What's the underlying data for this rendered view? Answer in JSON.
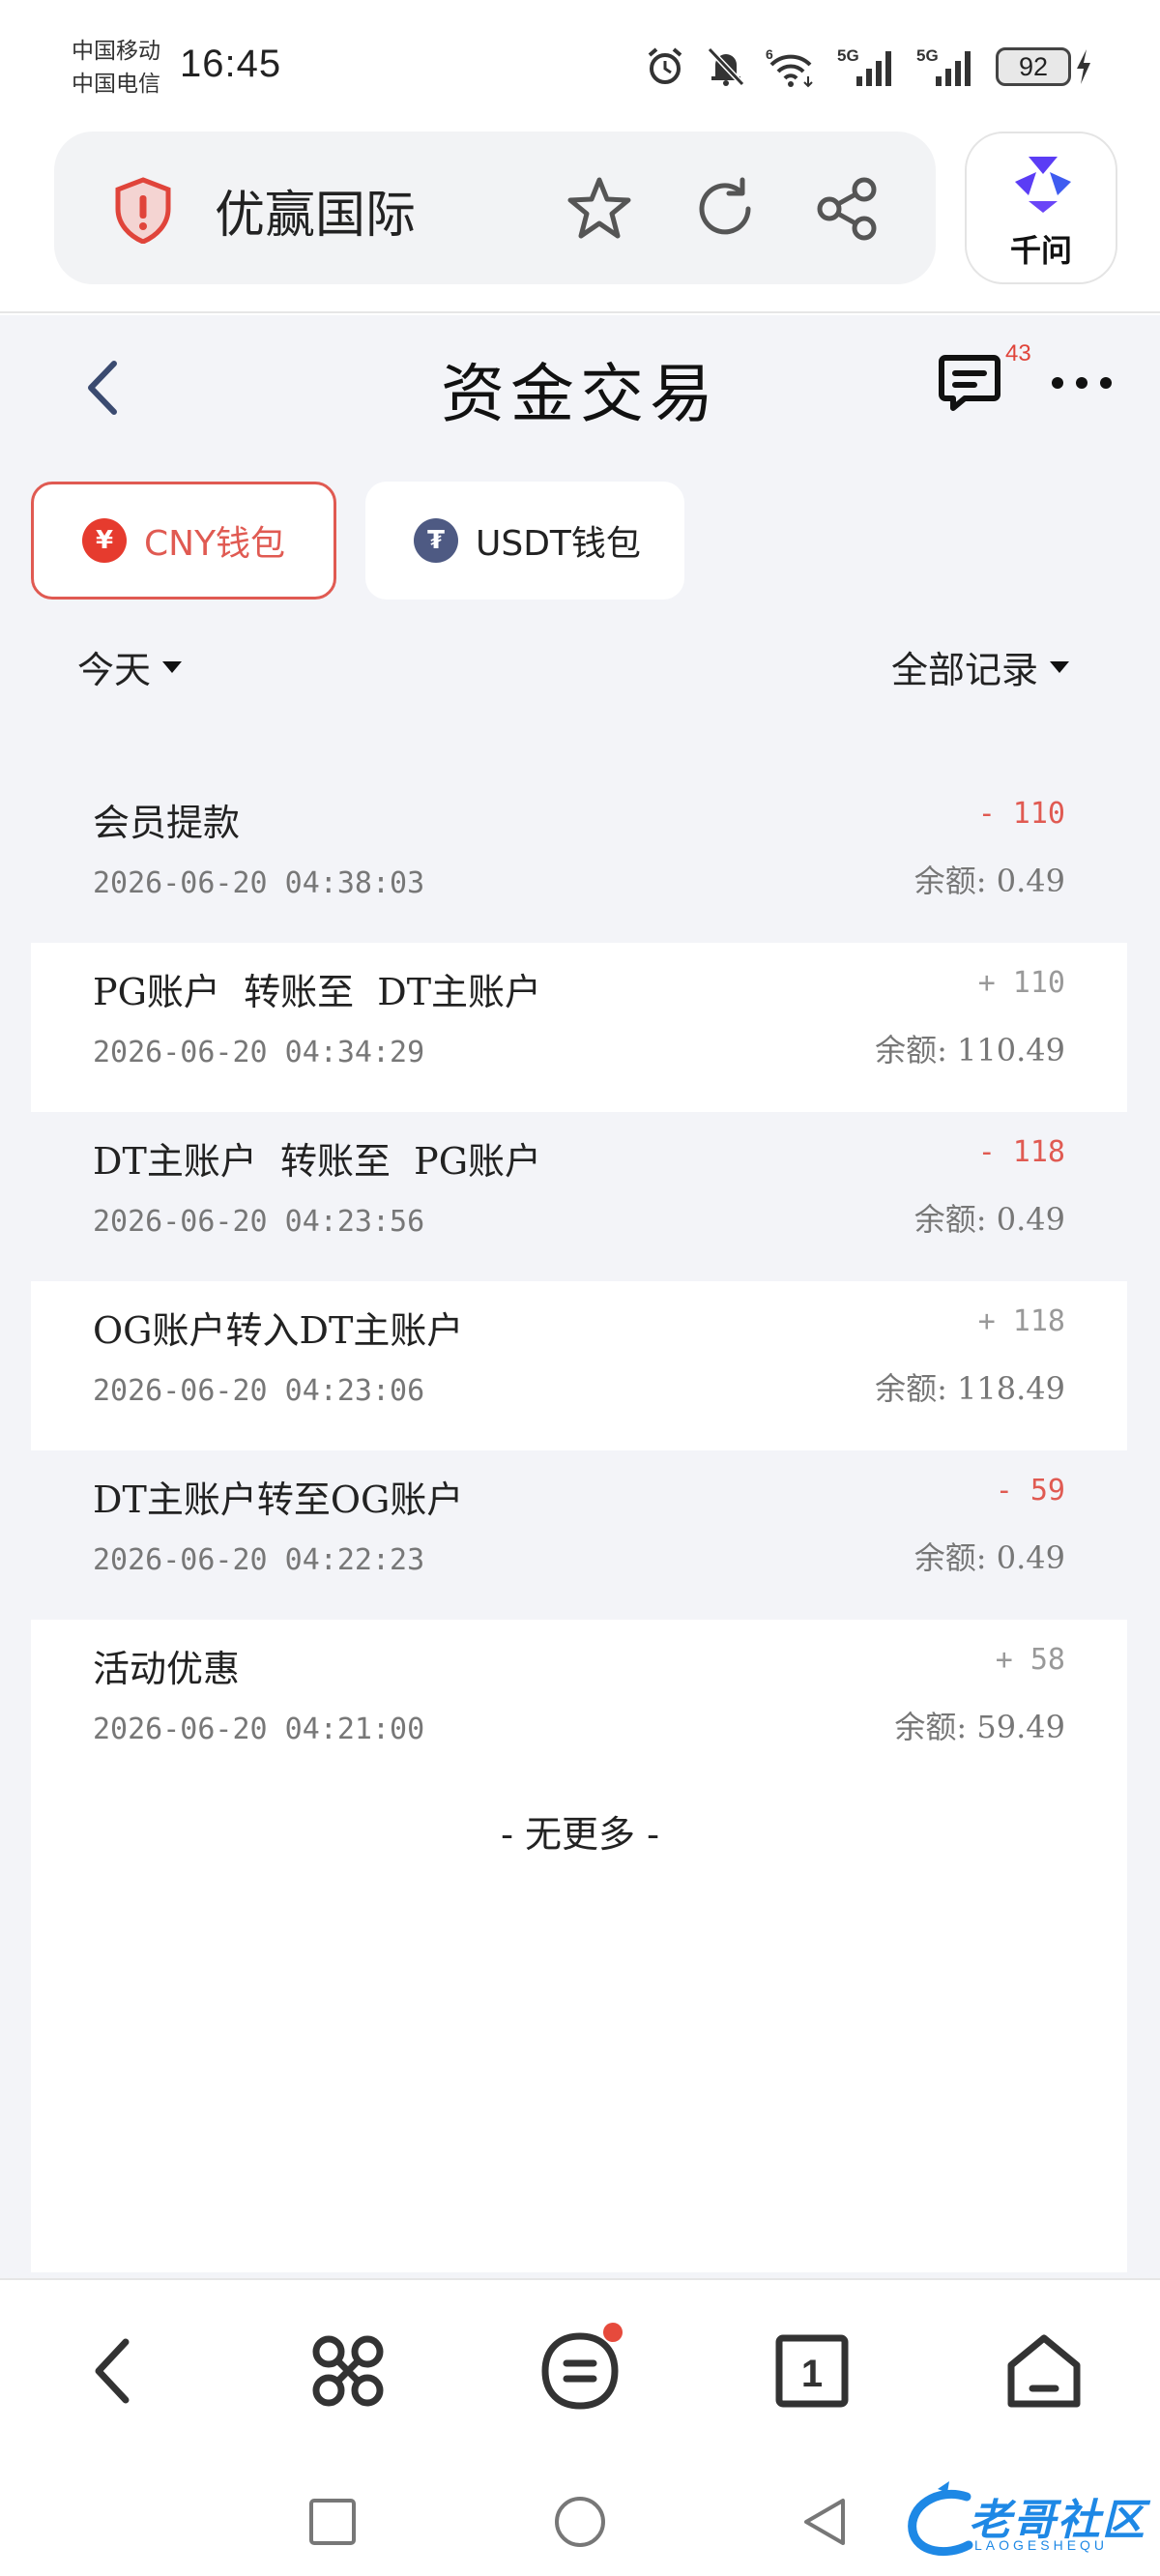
{
  "status_bar": {
    "carrier_1": "中国移动",
    "carrier_2": "中国电信",
    "time": "16:45",
    "battery": "92"
  },
  "browser": {
    "site_title": "优赢国际",
    "assistant_label": "千问"
  },
  "page": {
    "title": "资金交易",
    "message_count": "43"
  },
  "wallet_tabs": [
    {
      "label": "CNY钱包",
      "icon": "¥",
      "active": true
    },
    {
      "label": "USDT钱包",
      "icon": "₮",
      "active": false
    }
  ],
  "filters": {
    "date": "今天",
    "record_type": "全部记录"
  },
  "transactions": [
    {
      "title": "会员提款",
      "time": "2026-06-20 04:38:03",
      "amount": "- 110",
      "balance": "余额: 0.49"
    },
    {
      "title": "PG账户  转账至  DT主账户",
      "time": "2026-06-20 04:34:29",
      "amount": "+ 110",
      "balance": "余额: 110.49"
    },
    {
      "title": "DT主账户  转账至  PG账户",
      "time": "2026-06-20 04:23:56",
      "amount": "- 118",
      "balance": "余额: 0.49"
    },
    {
      "title": "OG账户转入DT主账户",
      "time": "2026-06-20 04:23:06",
      "amount": "+ 118",
      "balance": "余额: 118.49"
    },
    {
      "title": "DT主账户转至OG账户",
      "time": "2026-06-20 04:22:23",
      "amount": "- 59",
      "balance": "余额: 0.49"
    },
    {
      "title": "活动优惠",
      "time": "2026-06-20 04:21:00",
      "amount": "+ 58",
      "balance": "余额: 59.49"
    }
  ],
  "list_end": "- 无更多 -",
  "watermark": {
    "text": "老哥社区",
    "sub": "LAOGESHEQU"
  },
  "colors": {
    "accent_red": "#e05a52",
    "page_bg": "#f3f4f8",
    "usdt_icon": "#4e5a83",
    "assistant_logo": "#5b3df5"
  }
}
